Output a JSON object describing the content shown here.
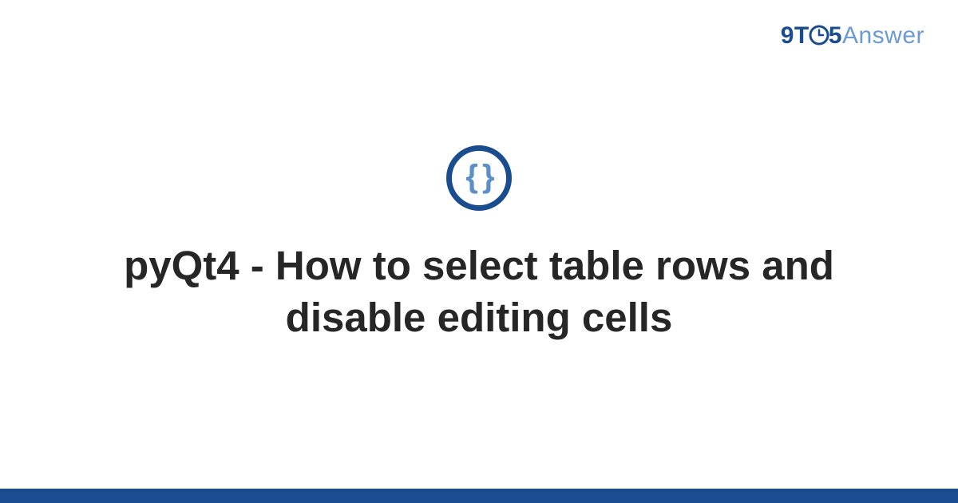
{
  "brand": {
    "part1": "9T",
    "part2": "5",
    "part3": "Answer"
  },
  "badge": {
    "symbol": "{ }"
  },
  "title": "pyQt4 - How to select table rows and disable editing cells",
  "colors": {
    "primary": "#1a4d8f",
    "secondary": "#6b9bd1",
    "badge_inner": "#5a8fc7",
    "text": "#262626"
  }
}
